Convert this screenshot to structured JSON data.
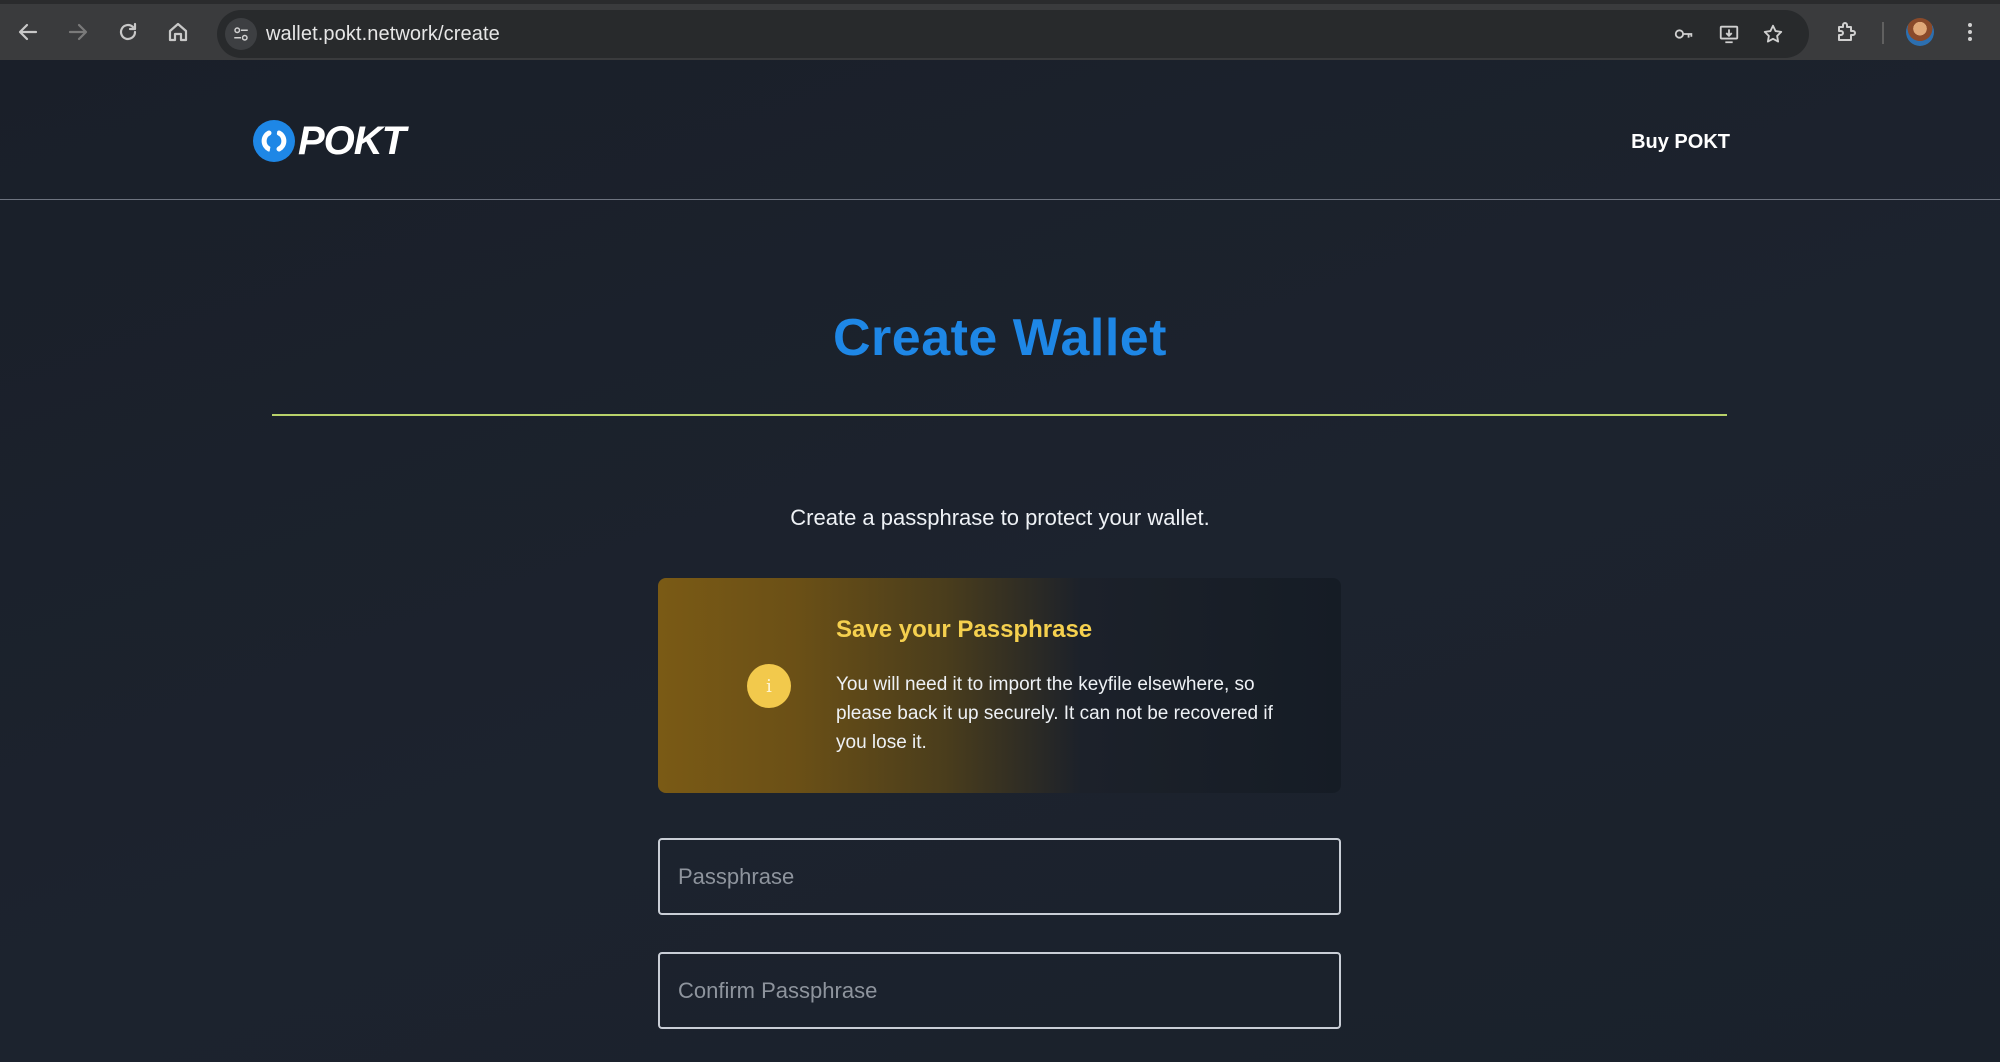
{
  "browser": {
    "url": "wallet.pokt.network/create"
  },
  "header": {
    "logo_text": "POKT",
    "buy_link": "Buy POKT"
  },
  "main": {
    "title": "Create Wallet",
    "subtitle": "Create a passphrase to protect your wallet.",
    "notice": {
      "icon": "i",
      "title": "Save your Passphrase",
      "body": "You will need it to import the keyfile elsewhere, so please back it up securely. It can not be recovered if you lose it."
    },
    "passphrase_placeholder": "Passphrase",
    "confirm_placeholder": "Confirm Passphrase"
  },
  "colors": {
    "accent": "#1e87e6",
    "rule": "#b8d16a",
    "warning": "#f5d04e"
  }
}
